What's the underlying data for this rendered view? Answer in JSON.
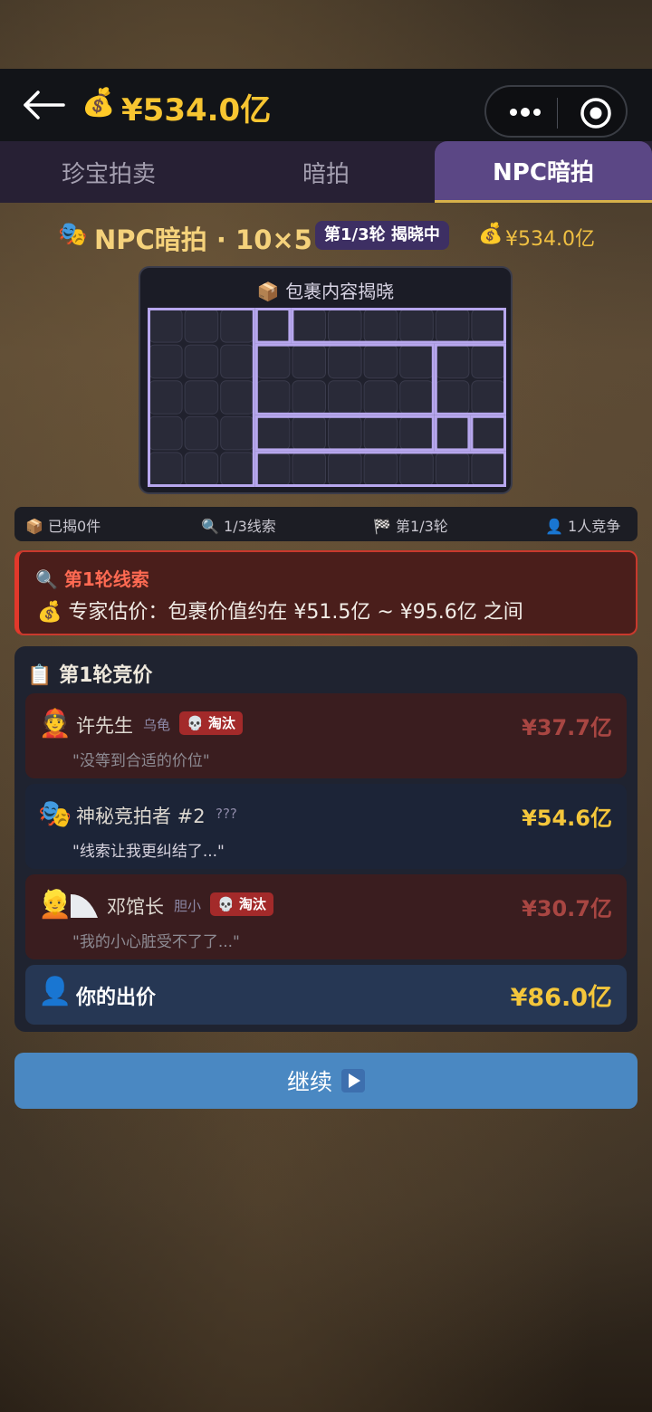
{
  "topbar": {
    "money": "¥534.0亿",
    "money_icon": "money-bag-icon"
  },
  "tabs": [
    {
      "label": "珍宝拍卖",
      "active": false
    },
    {
      "label": "暗拍",
      "active": false
    },
    {
      "label": "NPC暗拍",
      "active": true
    }
  ],
  "header": {
    "title": "NPC暗拍 · 10×5",
    "badge": "第1/3轮 揭晓中",
    "money": "¥534.0亿"
  },
  "grid": {
    "title": "包裹内容揭晓",
    "cols": 10,
    "rows": 5
  },
  "stats": {
    "revealed": "已揭0件",
    "clues": "1/3线索",
    "round": "第1/3轮",
    "competitors": "1人竞争"
  },
  "clue": {
    "title": "第1轮线索",
    "text": "专家估价：包裹价值约在 ¥51.5亿 ~ ¥95.6亿 之间"
  },
  "bids": {
    "title": "第1轮竞价",
    "bidders": [
      {
        "avatar": "🧑",
        "name": "许先生",
        "tag": "乌龟",
        "status": "淘汰",
        "amount": "¥37.7亿",
        "quote": "\"没等到合适的价位\""
      },
      {
        "avatar": "🎭",
        "name": "神秘竞拍者 #2",
        "tag": "???",
        "status": "",
        "amount": "¥54.6亿",
        "quote": "\"线索让我更纠结了...\""
      },
      {
        "avatar": "👱",
        "name": "邓馆长",
        "tag": "胆小",
        "status": "淘汰",
        "amount": "¥30.7亿",
        "quote": "\"我的小心脏受不了了...\""
      }
    ],
    "my_bid_label": "你的出价",
    "my_bid_amount": "¥86.0亿"
  },
  "continue_label": "继续",
  "colors": {
    "gold": "#f4c63b",
    "danger": "#c9392d",
    "accent": "#5b4785",
    "button": "#4a88c2"
  }
}
